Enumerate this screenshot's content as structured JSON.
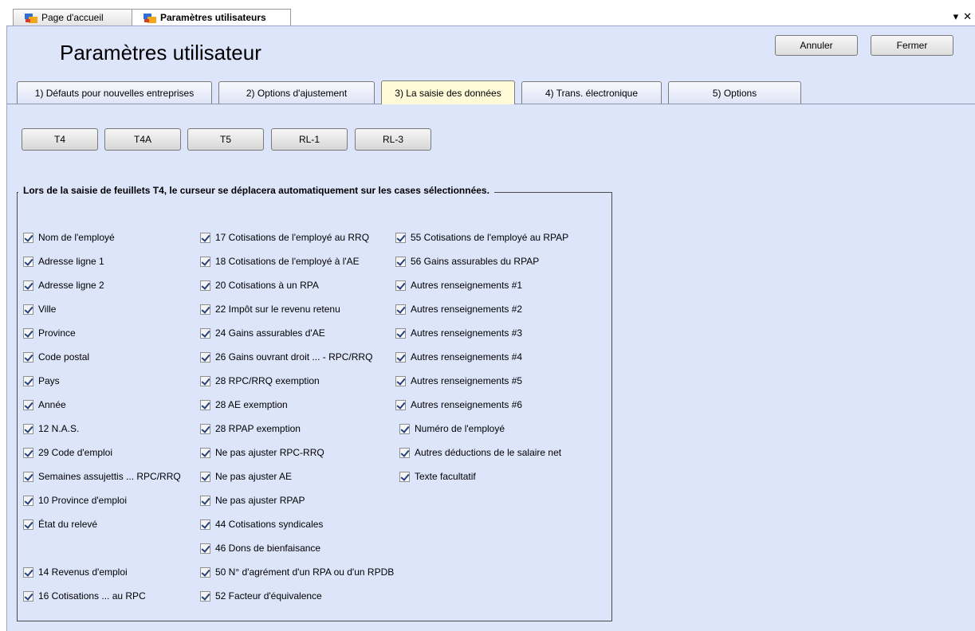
{
  "doc_tabs": [
    {
      "label": "Page d'accueil",
      "active": false
    },
    {
      "label": "Paramètres utilisateurs",
      "active": true
    }
  ],
  "window_controls": {
    "dropdown": "▾",
    "close": "✕"
  },
  "page_title": "Paramètres utilisateur",
  "buttons": {
    "cancel": "Annuler",
    "close": "Fermer"
  },
  "option_tabs": [
    {
      "label": "1) Défauts pour nouvelles entreprises",
      "active": false
    },
    {
      "label": "2) Options d'ajustement",
      "active": false
    },
    {
      "label": "3) La saisie des données",
      "active": true
    },
    {
      "label": "4) Trans. électronique",
      "active": false
    },
    {
      "label": "5) Options",
      "active": false
    }
  ],
  "doc_buttons": [
    "T4",
    "T4A",
    "T5",
    "RL-1",
    "RL-3"
  ],
  "group_title": "Lors de la saisie de feuillets T4, le curseur se déplacera automatiquement sur les cases sélectionnées.",
  "checkboxes": {
    "col1": [
      {
        "label": "Nom de l'employé",
        "checked": true
      },
      {
        "label": "Adresse ligne 1",
        "checked": true
      },
      {
        "label": "Adresse ligne 2",
        "checked": true
      },
      {
        "label": "Ville",
        "checked": true
      },
      {
        "label": "Province",
        "checked": true
      },
      {
        "label": "Code postal",
        "checked": true
      },
      {
        "label": "Pays",
        "checked": true
      },
      {
        "label": "Année",
        "checked": true
      },
      {
        "label": "12 N.A.S.",
        "checked": true
      },
      {
        "label": "29 Code d'emploi",
        "checked": true
      },
      {
        "label": "Semaines assujettis ... RPC/RRQ",
        "checked": true
      },
      {
        "label": "10 Province d'emploi",
        "checked": true
      },
      {
        "label": "État du relevé",
        "checked": true
      },
      {
        "label": "14 Revenus d'emploi",
        "checked": true
      },
      {
        "label": "16 Cotisations ... au RPC",
        "checked": true
      }
    ],
    "col2": [
      {
        "label": "17 Cotisations de l'employé au RRQ",
        "checked": true
      },
      {
        "label": "18 Cotisations de l'employé à l'AE",
        "checked": true
      },
      {
        "label": "20 Cotisations à un RPA",
        "checked": true
      },
      {
        "label": "22 Impôt sur le revenu retenu",
        "checked": true
      },
      {
        "label": "24 Gains assurables d'AE",
        "checked": true
      },
      {
        "label": "26 Gains ouvrant droit ... - RPC/RRQ",
        "checked": true
      },
      {
        "label": "28 RPC/RRQ exemption",
        "checked": true
      },
      {
        "label": "28 AE exemption",
        "checked": true
      },
      {
        "label": "28 RPAP exemption",
        "checked": true
      },
      {
        "label": "Ne pas ajuster RPC-RRQ",
        "checked": true
      },
      {
        "label": "Ne pas ajuster AE",
        "checked": true
      },
      {
        "label": "Ne pas ajuster RPAP",
        "checked": true
      },
      {
        "label": "44 Cotisations syndicales",
        "checked": true
      },
      {
        "label": "46 Dons de bienfaisance",
        "checked": true
      },
      {
        "label": "50 N° d'agrément d'un RPA ou d'un RPDB",
        "checked": true
      },
      {
        "label": "52 Facteur d'équivalence",
        "checked": true
      }
    ],
    "col3": [
      {
        "label": "55 Cotisations de l'employé au RPAP",
        "checked": true
      },
      {
        "label": "56 Gains assurables du RPAP",
        "checked": true
      },
      {
        "label": "Autres renseignements #1",
        "checked": true
      },
      {
        "label": "Autres renseignements #2",
        "checked": true
      },
      {
        "label": "Autres renseignements #3",
        "checked": true
      },
      {
        "label": "Autres renseignements #4",
        "checked": true
      },
      {
        "label": "Autres renseignements #5",
        "checked": true
      },
      {
        "label": "Autres renseignements #6",
        "checked": true
      },
      {
        "label": "Numéro de l'employé",
        "checked": true
      },
      {
        "label": "Autres déductions de le salaire net",
        "checked": true
      },
      {
        "label": "Texte facultatif",
        "checked": true
      }
    ]
  }
}
